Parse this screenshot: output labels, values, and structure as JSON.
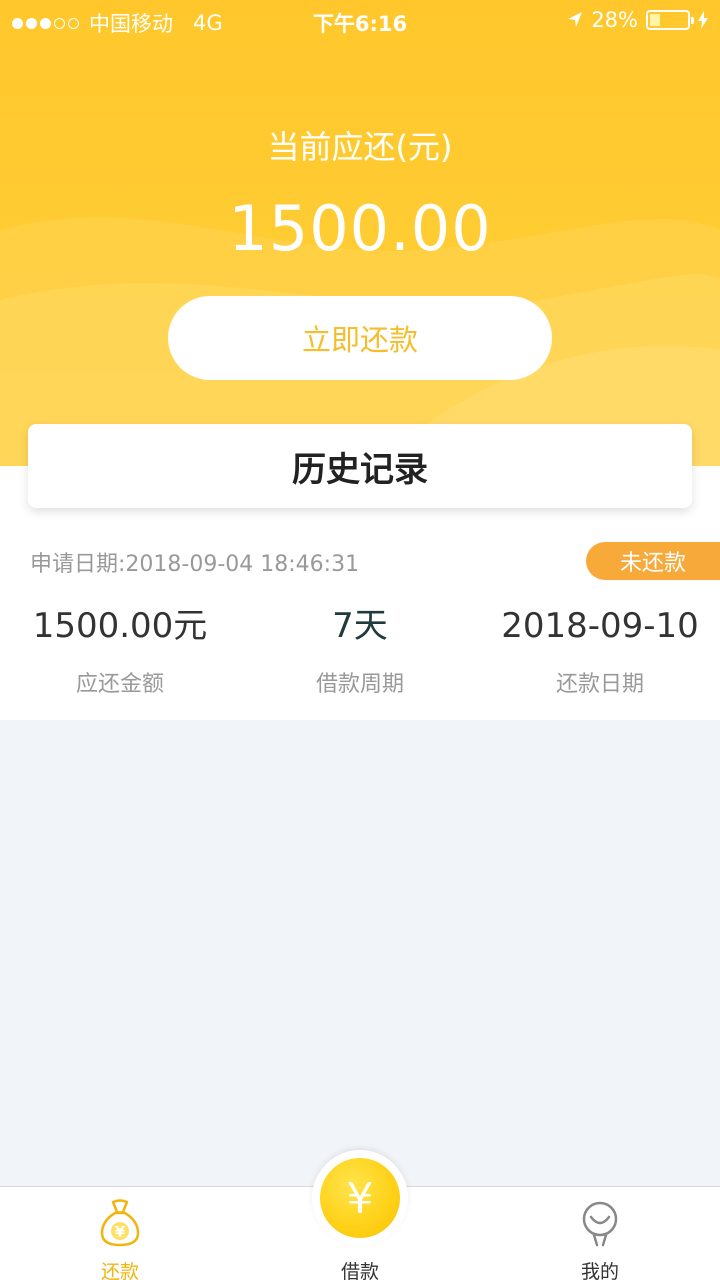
{
  "status_bar": {
    "carrier": "中国移动",
    "network": "4G",
    "time": "下午6:16",
    "battery": "28%"
  },
  "hero": {
    "due_label": "当前应还(元)",
    "due_amount": "1500.00",
    "repay_button": "立即还款"
  },
  "history": {
    "title": "历史记录"
  },
  "record": {
    "apply_date": "申请日期:2018-09-04 18:46:31",
    "status": "未还款",
    "columns": [
      {
        "value": "1500.00元",
        "label": "应还金额"
      },
      {
        "value": "7天",
        "label": "借款周期"
      },
      {
        "value": "2018-09-10",
        "label": "还款日期"
      }
    ]
  },
  "tab_bar": {
    "tabs": [
      {
        "label": "还款",
        "icon": "money-bag-icon",
        "active": true
      },
      {
        "label": "借款",
        "icon": "yen-coin-icon",
        "active": false
      },
      {
        "label": "我的",
        "icon": "user-icon",
        "active": false
      }
    ],
    "center_symbol": "¥"
  },
  "colors": {
    "brand": "#ffc72c",
    "accent_text": "#f4be2c",
    "badge": "#f7a93a",
    "active_tab": "#f2b50f"
  }
}
